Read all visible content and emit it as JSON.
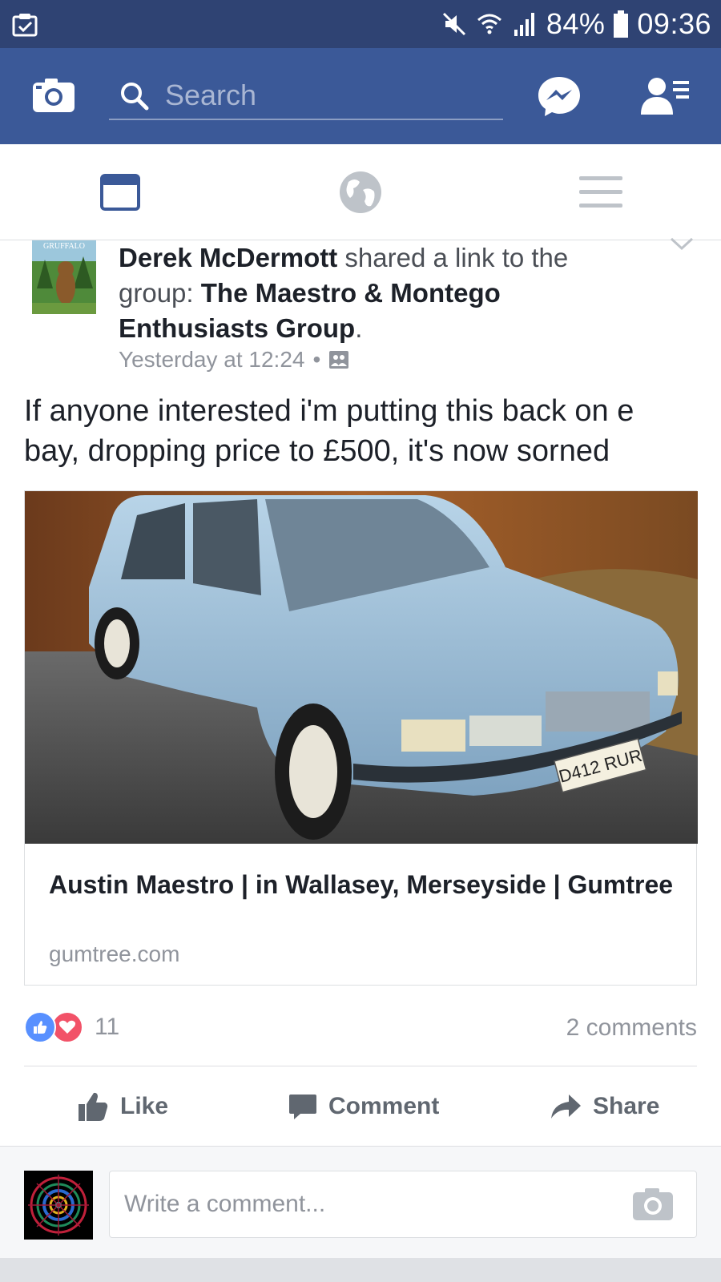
{
  "status_bar": {
    "battery": "84%",
    "time": "09:36",
    "icons": [
      "notification-clipboard-icon",
      "mute-icon",
      "wifi-icon",
      "signal-icon",
      "battery-icon"
    ]
  },
  "nav": {
    "search_placeholder": "Search",
    "icons": [
      "camera-icon",
      "search-icon",
      "messenger-icon",
      "friend-requests-icon"
    ],
    "brand_color": "#3b5998"
  },
  "tabs": [
    {
      "icon": "news-feed-icon",
      "active": true
    },
    {
      "icon": "globe-icon",
      "active": false
    },
    {
      "icon": "menu-icon",
      "active": false
    }
  ],
  "post": {
    "author": "Derek McDermott",
    "action_text": "shared a link to the group:",
    "group": "The Maestro & Montego Enthusiasts Group",
    "period": ".",
    "timestamp": "Yesterday at 12:24",
    "separator": "•",
    "privacy_icon": "group-privacy-icon",
    "text": "If anyone interested i'm putting this back on e bay, dropping price to £500, it's now sorned",
    "link": {
      "title": "Austin Maestro | in Wallasey, Merseyside | Gumtree",
      "domain": "gumtree.com",
      "plate": "D412 RUR"
    },
    "reaction_count": "11",
    "comments_count": "2 comments",
    "actions": {
      "like": "Like",
      "comment": "Comment",
      "share": "Share"
    },
    "avatar_book_title": "GRUFFALO"
  },
  "composer": {
    "placeholder": "Write a comment..."
  }
}
